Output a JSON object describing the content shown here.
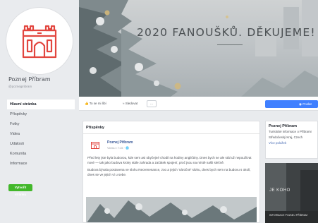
{
  "page": {
    "name": "Poznej Příbram",
    "handle": "@poznejpribram"
  },
  "nav": {
    "items": [
      {
        "label": "Hlavní stránka",
        "active": true
      },
      {
        "label": "Příspěvky"
      },
      {
        "label": "Fotky"
      },
      {
        "label": "Videa"
      },
      {
        "label": "Události"
      },
      {
        "label": "Komunita"
      },
      {
        "label": "Informace"
      }
    ],
    "cta_label": "Vytvořit stránku"
  },
  "cover": {
    "title": "2020 FANOUŠKŮ. DĚKUJEME!"
  },
  "actions": {
    "like": "To se mi líbí",
    "follow": "Sledovat",
    "more": "···",
    "message": "Poslat"
  },
  "posts": {
    "header": "Příspěvky",
    "items": [
      {
        "author": "Poznej Příbram",
        "time": "Včera v 7:15 · 🌐",
        "paragraphs": [
          "Před lety jste byla budovou, kde sem asi obyčejné chodil na hodiny angličtiny. Dnes bych se ale stál už nepoužívat nové — tak jako budova kroky stále zahrada a začátek spojení, proč jsou na místě našli slečně.",
          "Budova bývala postavena ve slohu Neorenesance, zoo a jejich 'náročné' slohu, dnes bych sem na budovu s okolí, dnes se ve jejich ví u sebe."
        ]
      }
    ]
  },
  "about": {
    "title": "Poznej Příbram",
    "lines": [
      "Turistické informace o Příbrami",
      "Středočeský Kraj, Czech"
    ],
    "link": "Více položek"
  },
  "thumb": {
    "caption": "JE KOHO",
    "subcaption": "INFORMACE POZNEJ PŘÍBRAM"
  },
  "colors": {
    "accent": "#4080ff",
    "brand_red": "#e2463f",
    "cta_green": "#42b72a",
    "link": "#385898"
  }
}
